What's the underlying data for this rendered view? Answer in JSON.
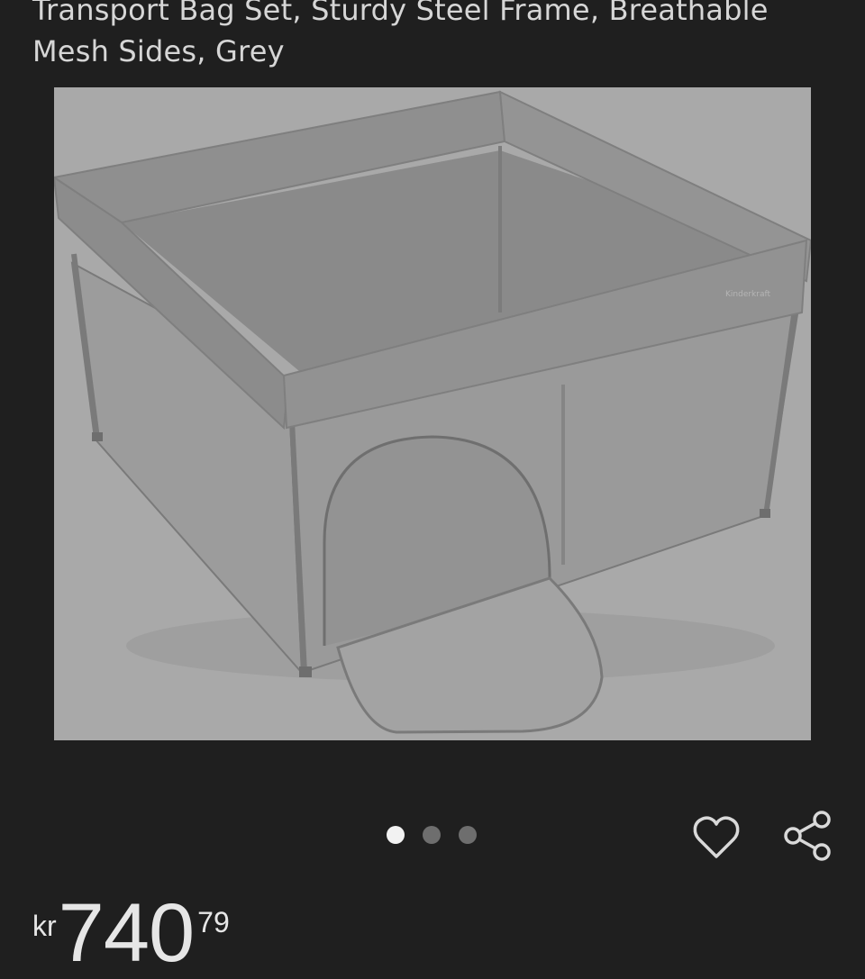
{
  "product": {
    "title": "Transport Bag Set, Sturdy Steel Frame, Breathable Mesh Sides, Grey",
    "image": {
      "subject": "grey square playpen with mesh sides and zip door",
      "brand_mark": "Kinderkraft"
    },
    "carousel": {
      "total": 3,
      "active_index": 0
    },
    "price": {
      "currency": "kr",
      "whole": "740",
      "fraction": "79"
    }
  },
  "actions": {
    "wishlist_icon": "heart-icon",
    "share_icon": "share-icon"
  },
  "colors": {
    "background": "#1f1f1f",
    "text": "#d6d6d6",
    "dot_active": "#f2f2f2",
    "dot_inactive": "#6e6e6e"
  }
}
